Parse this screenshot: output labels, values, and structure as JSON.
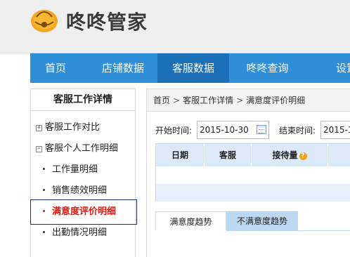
{
  "header": {
    "brand": "咚咚管家",
    "logo_icon": "bell-logo-icon",
    "logo_color": "#f5a623"
  },
  "nav": {
    "accent": "#2f8fd8",
    "active_color": "#1b6fb6",
    "items": [
      {
        "label": "首页"
      },
      {
        "label": "店铺数据"
      },
      {
        "label": "客服数据"
      },
      {
        "label": "咚咚查询"
      },
      {
        "label": "设置"
      }
    ],
    "active_index": 2
  },
  "sidebar": {
    "title": "客服工作详情",
    "groups": [
      {
        "label": "客服工作对比",
        "toggle": "+"
      },
      {
        "label": "客服个人工作明细",
        "toggle": "−"
      }
    ],
    "items": [
      {
        "label": "工作量明细"
      },
      {
        "label": "销售绩效明细"
      },
      {
        "label": "满意度评价明细"
      },
      {
        "label": "出勤情况明细"
      }
    ],
    "selected_index": 2,
    "selected_color": "#e8170d"
  },
  "breadcrumb": {
    "items": [
      "首页",
      "客服工作详情",
      "满意度评价明细"
    ],
    "separator": ">"
  },
  "filters": {
    "start_label": "开始时间:",
    "start_value": "2015-10-30",
    "end_label": "结束时间:",
    "end_value": "2015-1"
  },
  "table": {
    "columns": [
      "日期",
      "客服",
      "接待量"
    ],
    "help_icon": "question-icon"
  },
  "tabs": [
    {
      "label": "满意度趋势"
    },
    {
      "label": "不满意度趋势"
    }
  ],
  "active_tab": 0
}
